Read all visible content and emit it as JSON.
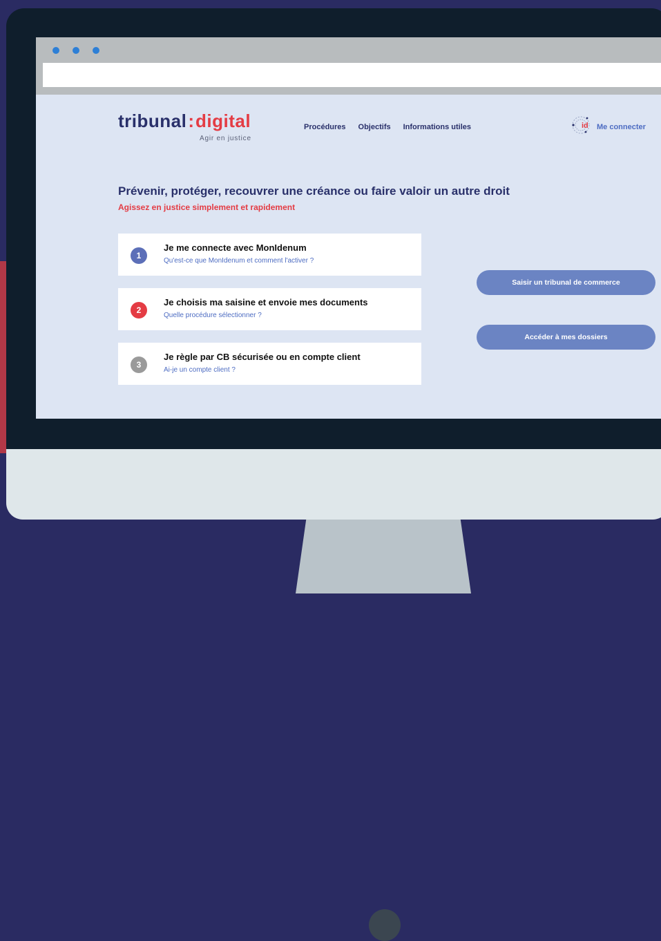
{
  "site": {
    "logo": {
      "word1": "tribunal",
      "separator": ":",
      "word2": "digital",
      "tagline": "Agir en justice"
    },
    "nav": {
      "items": [
        "Procédures",
        "Objectifs",
        "Informations utiles"
      ]
    },
    "login": {
      "label": "Me connecter",
      "icon": "id-icon"
    }
  },
  "hero": {
    "title": "Prévenir, protéger, recouvrer une créance ou faire valoir un autre droit",
    "subtitle": "Agissez en justice simplement et rapidement"
  },
  "steps": [
    {
      "number": "1",
      "title": "Je me connecte avec MonIdenum",
      "link": "Qu'est-ce que MonIdenum et comment l'activer ?",
      "color": "#5c6fb8"
    },
    {
      "number": "2",
      "title": "Je choisis ma saisine et envoie mes documents",
      "link": "Quelle procédure sélectionner ?",
      "color": "#e43c44"
    },
    {
      "number": "3",
      "title": "Je règle par CB sécurisée ou en compte client",
      "link": "Ai-je un compte client ?",
      "color": "#9a9a9a"
    }
  ],
  "actions": {
    "primary": "Saisir un tribunal de commerce",
    "secondary": "Accéder à mes dossiers"
  },
  "colors": {
    "background": "#2a2b62",
    "navy": "#29306a",
    "red": "#e43c44",
    "button": "#6b84c3",
    "page": "#dde5f3"
  }
}
